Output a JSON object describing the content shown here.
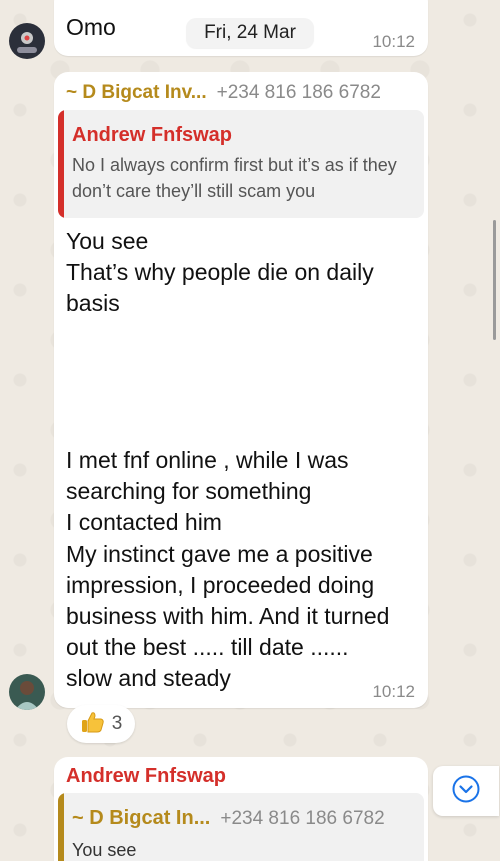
{
  "colors": {
    "background": "#efeae2",
    "bubble": "#ffffff",
    "sender_gold": "#b58a1c",
    "sender_red": "#d42f2a",
    "timestamp": "#8a8a8a",
    "accent_blue": "#1a73e8"
  },
  "top_message": {
    "text": "Omo",
    "time": "10:12"
  },
  "date_pill": "Fri, 24 Mar",
  "message_main": {
    "sender": "~ D Bigcat Inv...",
    "phone": "+234 816 186 6782",
    "quote": {
      "author": "Andrew Fnfswap",
      "text": "No I always confirm first but it’s as if they don’t care they’ll still scam you"
    },
    "lines_a": [
      "You see",
      "That’s why people die on daily",
      "basis"
    ],
    "lines_b": [
      "I met fnf online , while I was",
      "searching for something",
      "I contacted him",
      "My instinct gave me a positive",
      "impression, I proceeded doing",
      "business with him. And it turned",
      "out the best ..... till date ......",
      "slow and steady"
    ],
    "time": "10:12"
  },
  "reaction": {
    "icon": "thumbs-up-icon",
    "count": "3"
  },
  "message_bottom": {
    "sender": "Andrew Fnfswap",
    "quote": {
      "author": "~ D Bigcat In...",
      "phone": "+234 816 186 6782",
      "text": "You see"
    }
  },
  "scroll_down_icon": "chevron-down-circle-icon"
}
